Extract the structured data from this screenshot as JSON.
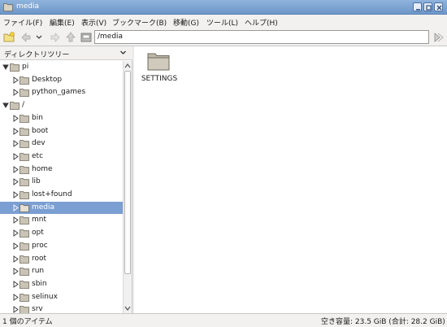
{
  "window": {
    "title": "media"
  },
  "menu": {
    "file": "ファイル(F)",
    "edit": "編集(E)",
    "view": "表示(V)",
    "bookmarks": "ブックマーク(B)",
    "go": "移動(G)",
    "tools": "ツール(L)",
    "help": "ヘルプ(H)"
  },
  "toolbar": {
    "location_value": "/media",
    "icons": [
      "new-tab-icon",
      "back-icon",
      "history-dropdown-icon",
      "forward-icon",
      "up-icon",
      "home-icon",
      "go-icon"
    ]
  },
  "sidepane": {
    "header": "ディレクトリツリー",
    "tree": [
      {
        "name": "pi",
        "depth": 0,
        "expanded": true,
        "selected": false
      },
      {
        "name": "Desktop",
        "depth": 1,
        "expanded": false,
        "selected": false
      },
      {
        "name": "python_games",
        "depth": 1,
        "expanded": false,
        "selected": false
      },
      {
        "name": "/",
        "depth": 0,
        "expanded": true,
        "selected": false
      },
      {
        "name": "bin",
        "depth": 1,
        "expanded": false,
        "selected": false
      },
      {
        "name": "boot",
        "depth": 1,
        "expanded": false,
        "selected": false
      },
      {
        "name": "dev",
        "depth": 1,
        "expanded": false,
        "selected": false
      },
      {
        "name": "etc",
        "depth": 1,
        "expanded": false,
        "selected": false
      },
      {
        "name": "home",
        "depth": 1,
        "expanded": false,
        "selected": false
      },
      {
        "name": "lib",
        "depth": 1,
        "expanded": false,
        "selected": false
      },
      {
        "name": "lost+found",
        "depth": 1,
        "expanded": false,
        "selected": false
      },
      {
        "name": "media",
        "depth": 1,
        "expanded": false,
        "selected": true
      },
      {
        "name": "mnt",
        "depth": 1,
        "expanded": false,
        "selected": false
      },
      {
        "name": "opt",
        "depth": 1,
        "expanded": false,
        "selected": false
      },
      {
        "name": "proc",
        "depth": 1,
        "expanded": false,
        "selected": false
      },
      {
        "name": "root",
        "depth": 1,
        "expanded": false,
        "selected": false
      },
      {
        "name": "run",
        "depth": 1,
        "expanded": false,
        "selected": false
      },
      {
        "name": "sbin",
        "depth": 1,
        "expanded": false,
        "selected": false
      },
      {
        "name": "selinux",
        "depth": 1,
        "expanded": false,
        "selected": false
      },
      {
        "name": "srv",
        "depth": 1,
        "expanded": false,
        "selected": false
      }
    ]
  },
  "main": {
    "items": [
      {
        "name": "SETTINGS",
        "icon": "folder-icon"
      }
    ]
  },
  "status": {
    "left": "1 個のアイテム",
    "right": "空き容量: 23.5 GiB (合計: 28.2 GiB)"
  },
  "colors": {
    "titlebar": "#6d96c8",
    "selection": "#7b9fd2",
    "folder": "#c9c4b5"
  }
}
